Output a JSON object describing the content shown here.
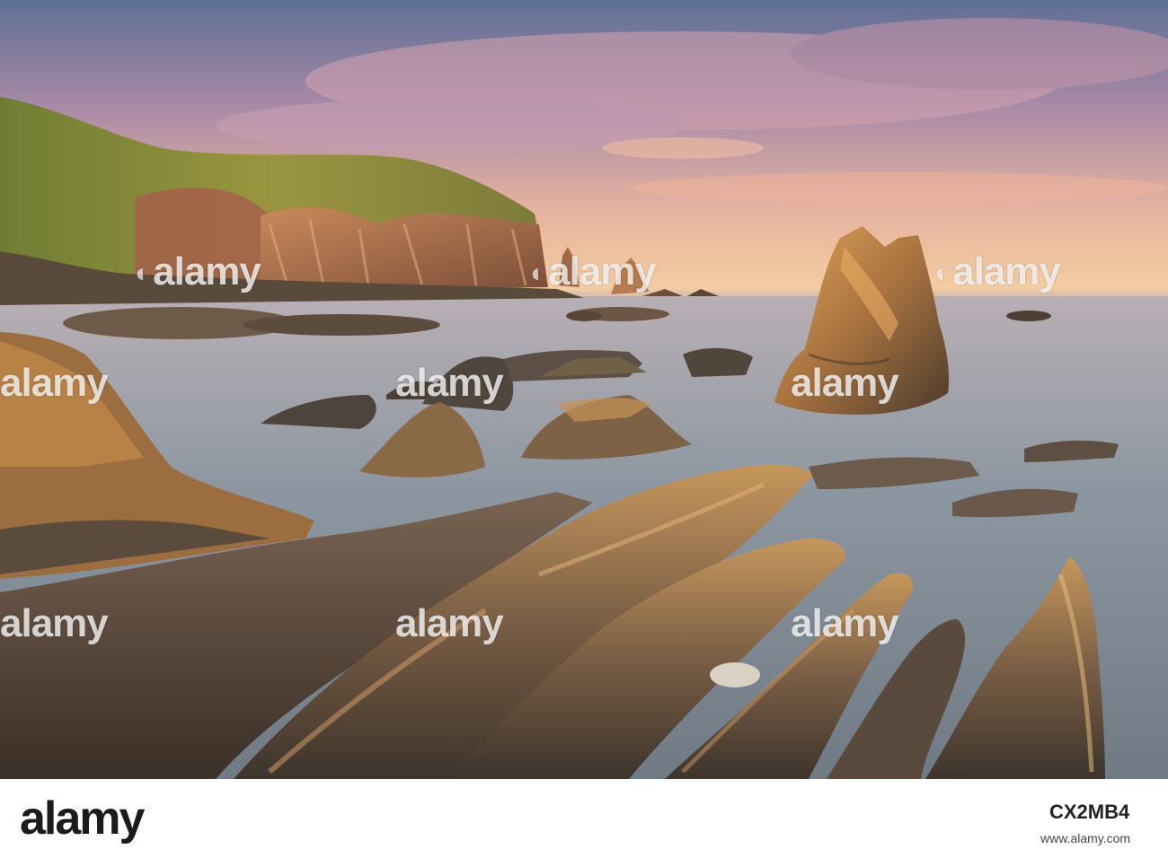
{
  "watermark": {
    "text": "alamy",
    "count": 9
  },
  "footer": {
    "logo": "alamy",
    "image_id": "CX2MB4",
    "url": "www.alamy.com"
  },
  "scene": {
    "subject": "rocky coastline at sunset",
    "colors": {
      "sky_top": "#6d7fa2",
      "sky_mid": "#c08fa0",
      "sky_horizon": "#f2c596",
      "sea": "#8f9aa3",
      "cliff_grass": "#8a8f3a",
      "cliff_rock": "#b5704f",
      "rock_lit": "#c79250",
      "rock_shadow": "#3a3229"
    }
  }
}
